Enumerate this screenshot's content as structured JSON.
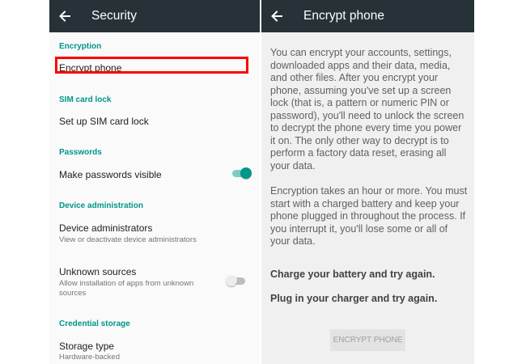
{
  "colors": {
    "toolbar": "#263238",
    "accent": "#009688",
    "highlight": "#ff0000"
  },
  "security": {
    "title": "Security",
    "back_icon": "arrow-left-icon",
    "sections": {
      "encryption": {
        "header": "Encryption",
        "items": [
          {
            "title": "Encrypt phone"
          }
        ]
      },
      "sim": {
        "header": "SIM card lock",
        "items": [
          {
            "title": "Set up SIM card lock"
          }
        ]
      },
      "passwords": {
        "header": "Passwords",
        "items": [
          {
            "title": "Make passwords visible",
            "toggle": true
          }
        ]
      },
      "device_admin": {
        "header": "Device administration",
        "items": [
          {
            "title": "Device administrators",
            "summary": "View or deactivate device administrators"
          },
          {
            "title": "Unknown sources",
            "summary": "Allow installation of apps from unknown sources",
            "toggle": false
          }
        ]
      },
      "credential": {
        "header": "Credential storage",
        "items": [
          {
            "title": "Storage type",
            "summary": "Hardware-backed"
          }
        ]
      }
    }
  },
  "encrypt": {
    "title": "Encrypt phone",
    "back_icon": "arrow-left-icon",
    "paragraph1": "You can encrypt your accounts, settings, downloaded apps and their data, media, and other files. After you encrypt your phone, assuming you've set up a screen lock (that is, a pattern or numeric PIN or password), you'll need to unlock the screen to decrypt the phone every time you power it on. The only other way to decrypt is to perform a factory data reset, erasing all your data.",
    "paragraph2": "Encryption takes an hour or more. You must start with a charged battery and keep your phone plugged in throughout the process. If you interrupt it, you'll lose some or all of your data.",
    "notice1": "Charge your battery and try again.",
    "notice2": "Plug in your charger and try again.",
    "button": "ENCRYPT PHONE"
  }
}
